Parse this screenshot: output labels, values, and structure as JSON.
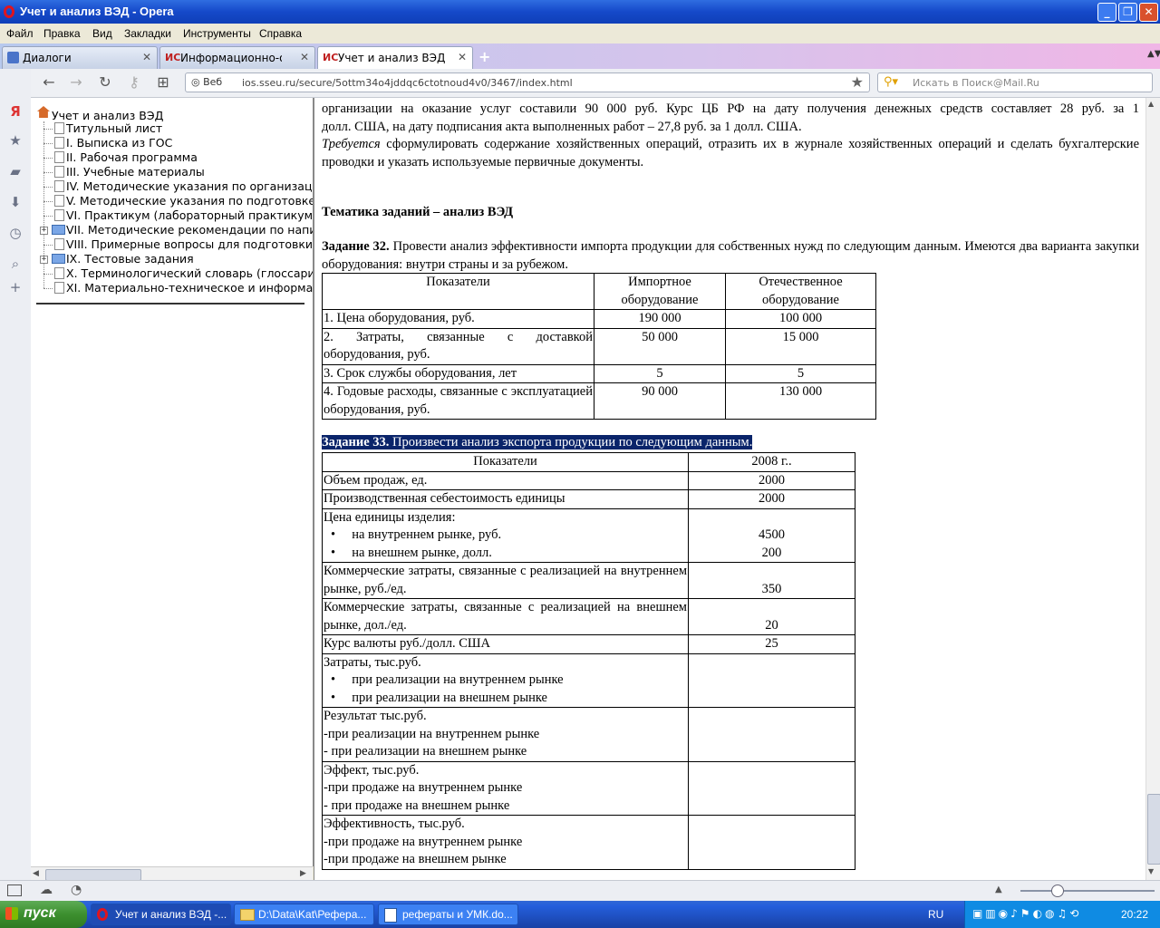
{
  "window": {
    "title": "Учет и анализ ВЭД - Opera"
  },
  "menu": [
    "Файл",
    "Правка",
    "Вид",
    "Закладки",
    "Инструменты",
    "Справка"
  ],
  "tabs": [
    {
      "label": "Диалоги"
    },
    {
      "label": "Информационно-образо..."
    },
    {
      "label": "Учет и анализ ВЭД"
    }
  ],
  "nav": {
    "web_label": "Веб",
    "url": "ios.sseu.ru/secure/5ottm34o4jddqc6ctotnoud4v0/3467/index.html",
    "search_placeholder": "Искать в Поиск@Mail.Ru"
  },
  "tree": {
    "root": "Учет и анализ ВЭД",
    "items": [
      "Титульный лист",
      "I. Выписка из ГОС",
      "II. Рабочая программа",
      "III. Учебные материалы",
      "IV. Методические указания по организац",
      "V. Методические указания по подготовке",
      "VI. Практикум (лабораторный практикум)",
      "VII. Методические рекомендации по напи",
      "VIII. Примерные вопросы для подготовки",
      "IX. Тестовые задания",
      "X. Терминологический словарь (глоссарий",
      "XI. Материально-техническое и информа"
    ]
  },
  "doc": {
    "para1_line1": "организации на оказание услуг составили 90 000 руб. Курс ЦБ РФ на дату получения денежных средств составляет 28 руб. за 1",
    "para1_line2": "долл. США, на дату подписания акта выполненных работ – 27,8 руб. за 1 долл. США.",
    "para2_italic": "Требуется",
    "para2_rest": " сформулировать содержание хозяйственных операций, отразить их в журнале хозяйственных операций и сделать бухгалтерские проводки и указать используемые первичные документы.",
    "section_heading": "Тематика заданий – анализ  ВЭД",
    "task32_label": "Задание 32.",
    "task32_text": " Провести анализ эффективности импорта продукции для собственных нужд по следующим данным. Имеются два варианта закупки оборудования: внутри страны и за рубежом.",
    "table32": {
      "headers": [
        "Показатели",
        "Импортное оборудование",
        "Отечественное оборудование"
      ],
      "rows": [
        [
          "1. Цена оборудования, руб.",
          "190 000",
          "100 000"
        ],
        [
          "2. Затраты, связанные с доставкой оборудования, руб.",
          "50 000",
          "15 000"
        ],
        [
          "3. Срок службы оборудования, лет",
          "5",
          "5"
        ],
        [
          "4. Годовые расходы, связанные с эксплуатацией оборудования, руб.",
          "90 000",
          "130 000"
        ]
      ]
    },
    "task33_label": "Задание 33.",
    "task33_text": " Произвести анализ экспорта продукции по следующим данным.",
    "table33": {
      "headers": [
        "Показатели",
        "2008 г.."
      ],
      "r1": [
        "Объем продаж, ед.",
        "2000"
      ],
      "r2": [
        "Производственная себестоимость единицы",
        "2000"
      ],
      "r3_title": "Цена единицы изделия:",
      "r3_b1": "на внутреннем рынке, руб.",
      "r3_b2": "на внешнем рынке, долл.",
      "r3_v1": "4500",
      "r3_v2": "200",
      "r4": [
        "Коммерческие затраты, связанные с реализацией на внутреннем рынке, руб./ед.",
        "350"
      ],
      "r5": [
        "Коммерческие затраты, связанные с реализацией на внешнем рынке, дол./ед.",
        "20"
      ],
      "r6": [
        "Курс валюты руб./долл. США",
        "25"
      ],
      "r7_title": "Затраты, тыс.руб.",
      "r7_b1": "при реализации на внутреннем рынке",
      "r7_b2": "при реализации на внешнем рынке",
      "r8": [
        "Результат тыс.руб.",
        "-при реализации на внутреннем рынке",
        "- при реализации на внешнем рынке"
      ],
      "r9": [
        "Эффект, тыс.руб.",
        "-при продаже на внутреннем рынке",
        "- при продаже на внешнем рынке"
      ],
      "r10": [
        "Эффективность, тыс.руб.",
        "-при продаже на внутреннем рынке",
        "-при продаже на внешнем рынке"
      ]
    }
  },
  "taskbar": {
    "start": "пуск",
    "buttons": [
      "Учет и анализ ВЭД -...",
      "D:\\Data\\Kat\\Рефера...",
      "рефераты и УМК.do..."
    ],
    "lang": "RU",
    "clock": "20:22"
  }
}
